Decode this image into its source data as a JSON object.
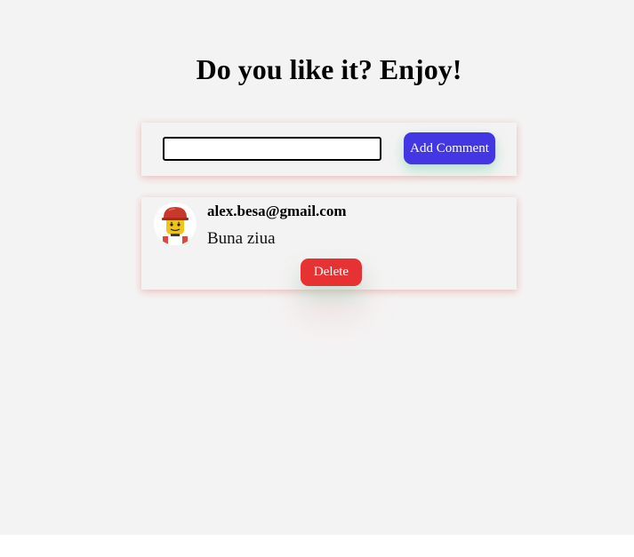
{
  "page": {
    "heading": "Do you like it? Enjoy!"
  },
  "form": {
    "input_value": "",
    "add_button_label": "Add Comment"
  },
  "comments": [
    {
      "author": "alex.besa@gmail.com",
      "text": "Buna ziua",
      "delete_label": "Delete",
      "avatar_icon": "lego-minifigure-avatar"
    }
  ],
  "colors": {
    "background": "#f4f3f3",
    "add_button": "#4237e3",
    "delete_button": "#e63232",
    "card_shadow": "#dc786e"
  }
}
